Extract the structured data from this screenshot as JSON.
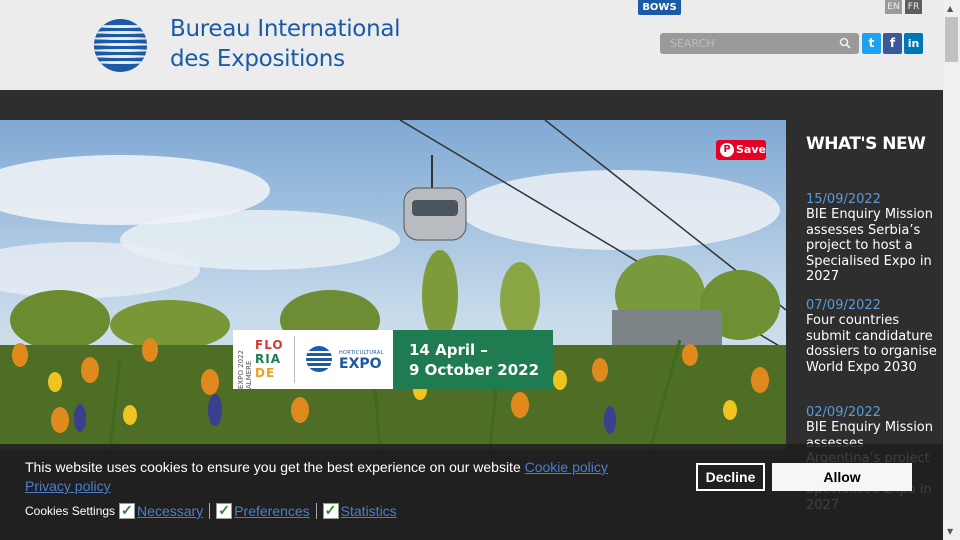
{
  "header": {
    "logo_line1": "Bureau International",
    "logo_line2": "des Expositions",
    "bows_label": "BOWS",
    "lang_en": "EN",
    "lang_fr": "FR",
    "close_symbol": "✕",
    "search_placeholder": "SEARCH",
    "social": {
      "twitter": "t",
      "facebook": "f",
      "linkedin": "in"
    }
  },
  "hero": {
    "pinterest_save": "Save",
    "banner": {
      "year_vertical": "EXPO 2022 ALMERE",
      "floriade_l1": "FLO",
      "floriade_l2": "RIA",
      "floriade_l3": "DE",
      "expo_small": "HORTICULTURAL",
      "expo_big": "EXPO",
      "date_line1": "14 April –",
      "date_line2": "9 October 2022"
    }
  },
  "news": {
    "heading": "WHAT'S NEW",
    "items": [
      {
        "date": "15/09/2022",
        "title": "BIE Enquiry Mission assesses Serbia’s project to host a Specialised Expo in 2027"
      },
      {
        "date": "07/09/2022",
        "title": "Four countries submit candidature dossiers to organise World Expo 2030"
      },
      {
        "date": "02/09/2022",
        "title": "BIE Enquiry Mission assesses Argentina’s project to host a Specialised Expo in 2027"
      }
    ]
  },
  "cookie": {
    "message": "This website uses cookies to ensure you get the best experience on our website",
    "policy_link": "Cookie policy",
    "privacy_link": "Privacy policy",
    "decline": "Decline",
    "allow": "Allow",
    "settings_label": "Cookies Settings",
    "options": [
      "Necessary",
      "Preferences",
      "Statistics"
    ]
  },
  "colors": {
    "brand_blue": "#1a5aa6",
    "news_date": "#5a9bd8",
    "banner_green": "#1f7b50",
    "pinterest": "#e60023"
  }
}
